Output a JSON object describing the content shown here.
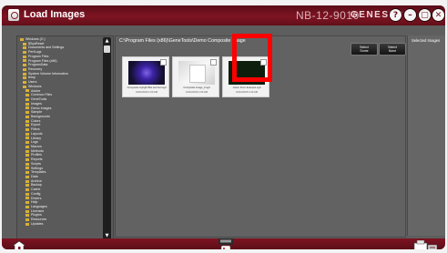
{
  "window": {
    "title": "Load Images",
    "serial": "NB-12-9010",
    "brand": "GENESYS",
    "controls": [
      "help-icon",
      "minimize-icon",
      "maximize-icon",
      "close-icon"
    ]
  },
  "folder_tree": {
    "items": [
      "Windows (C:)",
      "$SysReset",
      "Documents and Settings",
      "PerfLogs",
      "Program Files",
      "Program Files (x86)",
      "ProgramData",
      "Recovery",
      "System Volume Information",
      "temp",
      "Users",
      "Windows",
      "Adobe",
      "Common Files",
      "GeneTools",
      "Images",
      "Demo Images",
      "Sample",
      "Backgrounds",
      "Colors",
      "Export",
      "Filters",
      "Layouts",
      "Library",
      "Logs",
      "Macros",
      "Methods",
      "Profiles",
      "Reports",
      "Scripts",
      "Settings",
      "Templates",
      "Data",
      "Archive",
      "Backup",
      "Cache",
      "Config",
      "Drivers",
      "Help",
      "Languages",
      "Licenses",
      "Plugins",
      "Resources",
      "Updates"
    ]
  },
  "main": {
    "path": "C:\\Program Files (x86)\\GeneTools\\Demo Composite Image",
    "buttons": [
      {
        "label_top": "Select",
        "label_bottom": "Some"
      },
      {
        "label_top": "Select",
        "label_bottom": "None"
      }
    ],
    "thumbnails": [
      {
        "name": "Composite Upright Blot and Gel.sgd",
        "date": "01/01/2016 1:00 AM"
      },
      {
        "name": "Composite Image_2.sgd",
        "date": "01/01/2016 1:00 AM"
      },
      {
        "name": "Green Fluor Example.sgd",
        "date": "01/01/2016 1:00 AM"
      }
    ]
  },
  "selected_panel": {
    "title": "Selected Images"
  },
  "bottom_bar": {
    "icons": [
      "home-icon",
      "load-icon",
      "print-icon"
    ]
  },
  "colors": {
    "accent": "#7e1422",
    "highlight": "#ff0000",
    "panel": "#5e5e5e"
  }
}
